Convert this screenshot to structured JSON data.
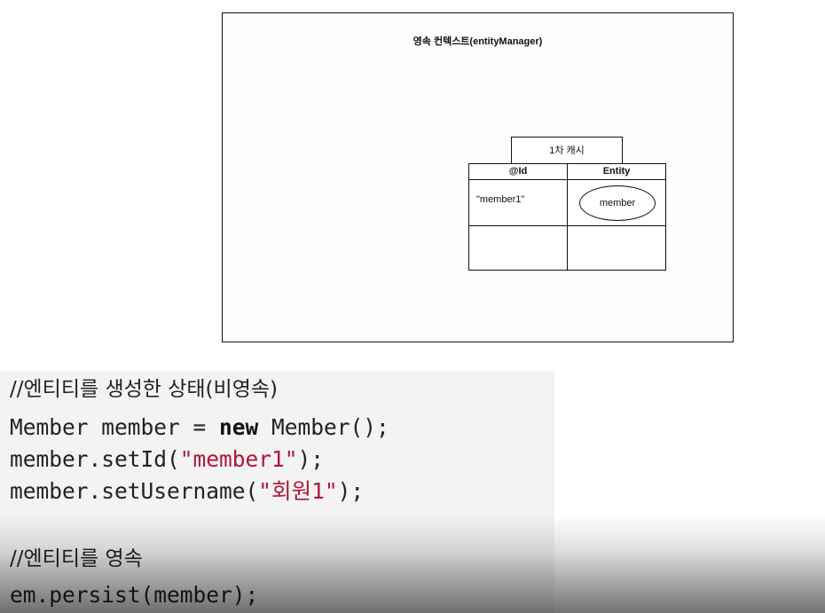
{
  "diagram": {
    "context_title": "영속 컨텍스트(entityManager)",
    "cache_label": "1차 캐시",
    "table": {
      "headers": [
        "@Id",
        "Entity"
      ],
      "rows": [
        {
          "id": "\"member1\"",
          "entity": "member"
        },
        {
          "id": "",
          "entity": ""
        }
      ]
    }
  },
  "code": {
    "comment1": "//엔티티를 생성한 상태(비영속)",
    "line1_prefix": "Member member = ",
    "line1_kw": "new",
    "line1_suffix": " Member();",
    "line2_prefix": "member.setId(",
    "line2_str": "\"member1\"",
    "line2_suffix": ");",
    "line3_prefix": "member.setUsername(",
    "line3_str": "\"회원1\"",
    "line3_suffix": ");",
    "comment2": "//엔티티를 영속",
    "line4": "em.persist(member);"
  }
}
